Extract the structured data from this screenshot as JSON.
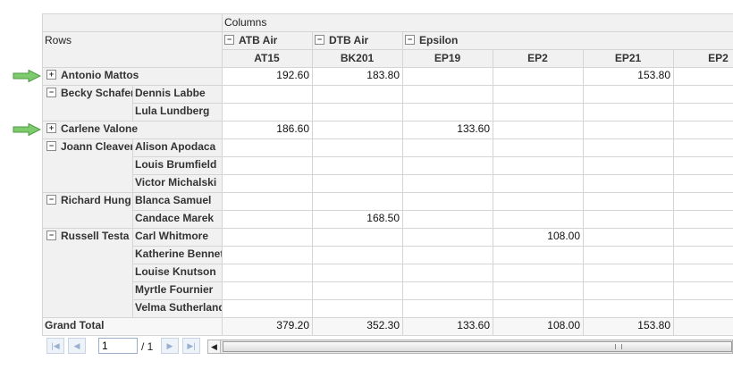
{
  "header": {
    "columns_label": "Columns",
    "rows_label": "Rows",
    "groups": [
      "ATB Air",
      "DTB Air",
      "Epsilon"
    ],
    "group_toggle": "−",
    "subcolumns": [
      "AT15",
      "BK201",
      "EP19",
      "EP2",
      "EP21",
      "EP2"
    ]
  },
  "rows": [
    {
      "toggle": "+",
      "name": "Antonio Mattos",
      "values": [
        "192.60",
        "183.80",
        "",
        "",
        "153.80",
        ""
      ]
    },
    {
      "toggle": "−",
      "name": "Becky Schafer",
      "sub": "Dennis Labbe",
      "values": [
        "",
        "",
        "",
        "",
        "",
        ""
      ]
    },
    {
      "sub": "Lula Lundberg",
      "values": [
        "",
        "",
        "",
        "",
        "",
        ""
      ]
    },
    {
      "toggle": "+",
      "name": "Carlene Valone",
      "values": [
        "186.60",
        "",
        "133.60",
        "",
        "",
        ""
      ]
    },
    {
      "toggle": "−",
      "name": "Joann Cleaver",
      "sub": "Alison Apodaca",
      "values": [
        "",
        "",
        "",
        "",
        "",
        ""
      ]
    },
    {
      "sub": "Louis Brumfield",
      "values": [
        "",
        "",
        "",
        "",
        "",
        ""
      ]
    },
    {
      "sub": "Victor Michalski",
      "values": [
        "",
        "",
        "",
        "",
        "",
        ""
      ]
    },
    {
      "toggle": "−",
      "name": "Richard Hung",
      "sub": "Blanca Samuel",
      "values": [
        "",
        "",
        "",
        "",
        "",
        ""
      ]
    },
    {
      "sub": "Candace Marek",
      "values": [
        "",
        "168.50",
        "",
        "",
        "",
        ""
      ]
    },
    {
      "toggle": "−",
      "name": "Russell Testa",
      "sub": "Carl Whitmore",
      "values": [
        "",
        "",
        "",
        "108.00",
        "",
        ""
      ]
    },
    {
      "sub": "Katherine Bennett",
      "values": [
        "",
        "",
        "",
        "",
        "",
        ""
      ]
    },
    {
      "sub": "Louise Knutson",
      "values": [
        "",
        "",
        "",
        "",
        "",
        ""
      ]
    },
    {
      "sub": "Myrtle Fournier",
      "values": [
        "",
        "",
        "",
        "",
        "",
        ""
      ]
    },
    {
      "sub": "Velma Sutherland",
      "values": [
        "",
        "",
        "",
        "",
        "",
        ""
      ]
    }
  ],
  "grand_total": {
    "label": "Grand Total",
    "values": [
      "379.20",
      "352.30",
      "133.60",
      "108.00",
      "153.80",
      ""
    ]
  },
  "pager": {
    "page_value": "1",
    "page_total": "/ 1",
    "first_icon": "first-page-icon",
    "prev_icon": "prev-page-icon",
    "next_icon": "next-page-icon",
    "last_icon": "last-page-icon"
  },
  "colors": {
    "header_bg": "#f1f1f1",
    "grid_line": "#d5d5d5",
    "arrow_fill": "#7ecb6e",
    "arrow_stroke": "#4e9a43"
  }
}
